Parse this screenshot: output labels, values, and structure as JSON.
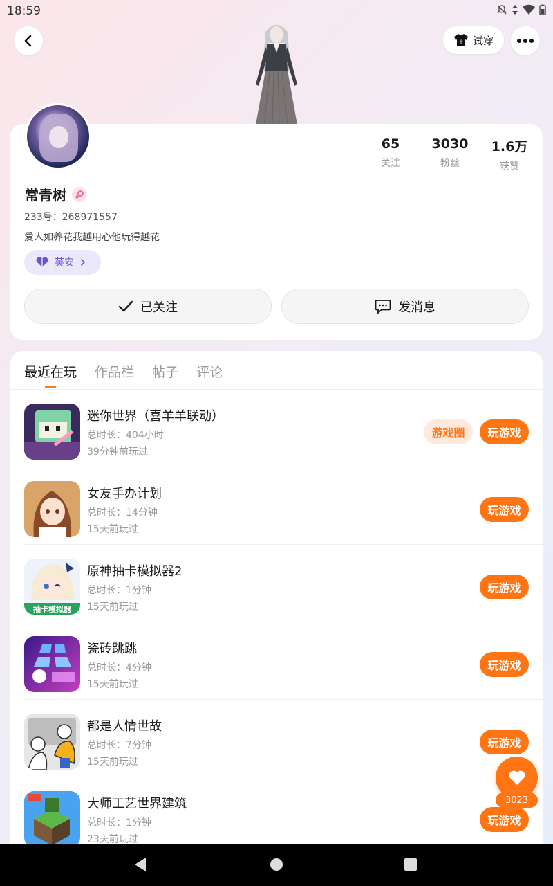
{
  "status_bar": {
    "time": "18:59"
  },
  "header": {
    "try_on_label": "试穿"
  },
  "profile": {
    "stats": [
      {
        "value": "65",
        "label": "关注"
      },
      {
        "value": "3030",
        "label": "粉丝"
      },
      {
        "value": "1.6万",
        "label": "获赞"
      }
    ],
    "name": "常青树",
    "uid": "233号：268971557",
    "bio": "爱人如养花我越用心他玩得越花",
    "relation_tag": "芙安",
    "follow_button": "已关注",
    "message_button": "发消息"
  },
  "tabs": [
    {
      "label": "最近在玩",
      "active": true
    },
    {
      "label": "作品栏",
      "active": false
    },
    {
      "label": "帖子",
      "active": false
    },
    {
      "label": "评论",
      "active": false
    }
  ],
  "games": [
    {
      "name": "迷你世界（喜羊羊联动）",
      "duration": "总时长：404小时",
      "last_played": "39分钟前玩过",
      "circle_label": "游戏圈",
      "play_label": "玩游戏"
    },
    {
      "name": "女友手办计划",
      "duration": "总时长：14分钟",
      "last_played": "15天前玩过",
      "play_label": "玩游戏"
    },
    {
      "name": "原神抽卡模拟器2",
      "duration": "总时长：1分钟",
      "last_played": "15天前玩过",
      "play_label": "玩游戏",
      "icon_text": "抽卡模拟器"
    },
    {
      "name": "瓷砖跳跳",
      "duration": "总时长：4分钟",
      "last_played": "15天前玩过",
      "play_label": "玩游戏"
    },
    {
      "name": "都是人情世故",
      "duration": "总时长：7分钟",
      "last_played": "15天前玩过",
      "play_label": "玩游戏"
    },
    {
      "name": "大师工艺世界建筑",
      "duration": "总时长：1分钟",
      "last_played": "23天前玩过",
      "play_label": "玩游戏"
    }
  ],
  "like_fab": {
    "count": "3023"
  },
  "colors": {
    "accent": "#ff7413",
    "accent_light": "#ffe9dd",
    "tag_purple": "#6a55c9"
  }
}
